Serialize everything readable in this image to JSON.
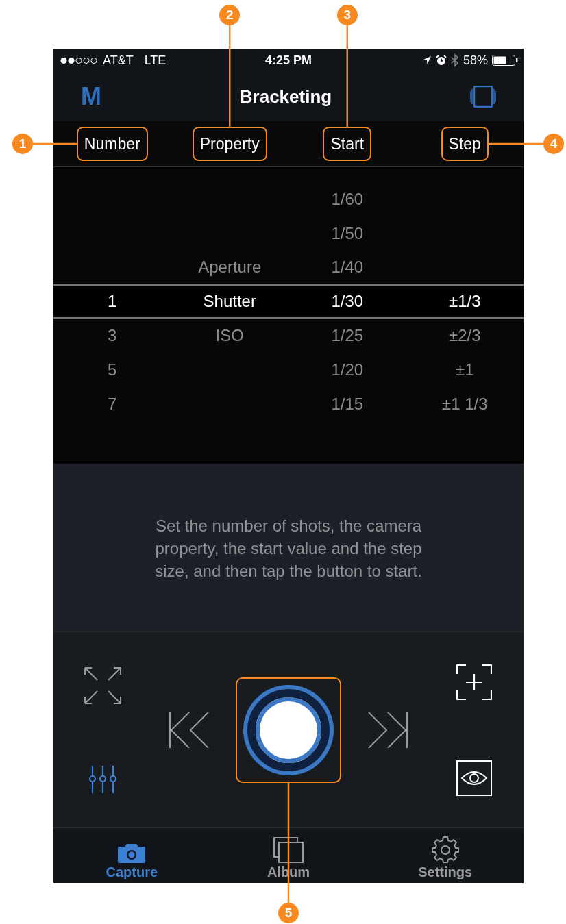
{
  "status_bar": {
    "carrier": "AT&T",
    "network": "LTE",
    "time": "4:25 PM",
    "battery": "58%"
  },
  "nav": {
    "mode": "M",
    "title": "Bracketing"
  },
  "columns": [
    {
      "label": "Number",
      "callout": "1"
    },
    {
      "label": "Property",
      "callout": "2"
    },
    {
      "label": "Start",
      "callout": "3"
    },
    {
      "label": "Step",
      "callout": "4"
    }
  ],
  "rows": [
    {
      "start": "1/60",
      "selected": false
    },
    {
      "start": "1/50",
      "selected": false
    },
    {
      "property": "Aperture",
      "start": "1/40",
      "selected": false
    },
    {
      "number": "1",
      "property": "Shutter",
      "start": "1/30",
      "step": "±1/3",
      "selected": true
    },
    {
      "number": "3",
      "property": "ISO",
      "start": "1/25",
      "step": "±2/3",
      "selected": false
    },
    {
      "number": "5",
      "start": "1/20",
      "step": "±1",
      "selected": false
    },
    {
      "number": "7",
      "start": "1/15",
      "step": "±1 1/3",
      "selected": false
    }
  ],
  "description": "Set the number of shots, the camera property, the start value and the step size, and then tap the button to start.",
  "shutter": {
    "callout": "5"
  },
  "tabs": [
    {
      "label": "Capture",
      "selected": true
    },
    {
      "label": "Album",
      "selected": false
    },
    {
      "label": "Settings",
      "selected": false
    }
  ]
}
